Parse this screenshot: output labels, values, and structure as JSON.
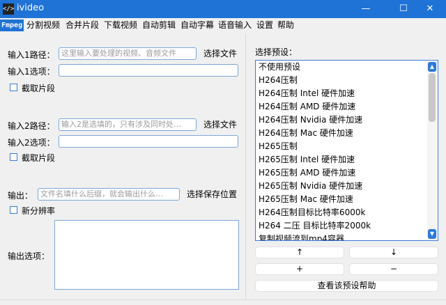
{
  "window": {
    "icon_text": "</>",
    "title": "ivideo",
    "minimize": "—",
    "maximize": "☐",
    "close": "✕"
  },
  "menu": [
    "Fmpeg",
    "分割视频",
    "合并片段",
    "下载视频",
    "自动剪辑",
    "自动字幕",
    "语音输入",
    "设置",
    "帮助"
  ],
  "left": {
    "input1_path_label": "输入1路径：",
    "input1_path_placeholder": "这里输入要处理的视频、音频文件",
    "input1_choose": "选择文件",
    "input1_opts_label": "输入1选项：",
    "input1_clip": "截取片段",
    "input2_path_label": "输入2路径：",
    "input2_path_placeholder": "输入2是选填的，只有涉及同时处…",
    "input2_choose": "选择文件",
    "input2_opts_label": "输入2选项：",
    "input2_clip": "截取片段",
    "output_label": "输出：",
    "output_placeholder": "文件名填什么后缀，就会输出什么…",
    "output_choose": "选择保存位置",
    "new_resolution": "新分辨率",
    "output_opts_label": "输出选项："
  },
  "right": {
    "preset_label": "选择预设：",
    "presets": [
      "不使用预设",
      "H264压制",
      "H264压制 Intel 硬件加速",
      "H264压制 AMD 硬件加速",
      "H264压制 Nvidia 硬件加速",
      "H264压制 Mac 硬件加速",
      "H265压制",
      "H265压制 Intel 硬件加速",
      "H265压制 AMD 硬件加速",
      "H265压制 Nvidia 硬件加速",
      "H265压制 Mac 硬件加速",
      "H264压制目标比特率6000k",
      "H264 二压 目标比特率2000k",
      "复制视频流到mp4容器"
    ],
    "btn_up": "↑",
    "btn_down": "↓",
    "btn_add": "+",
    "btn_remove": "−",
    "help_button": "查看该预设帮助"
  }
}
